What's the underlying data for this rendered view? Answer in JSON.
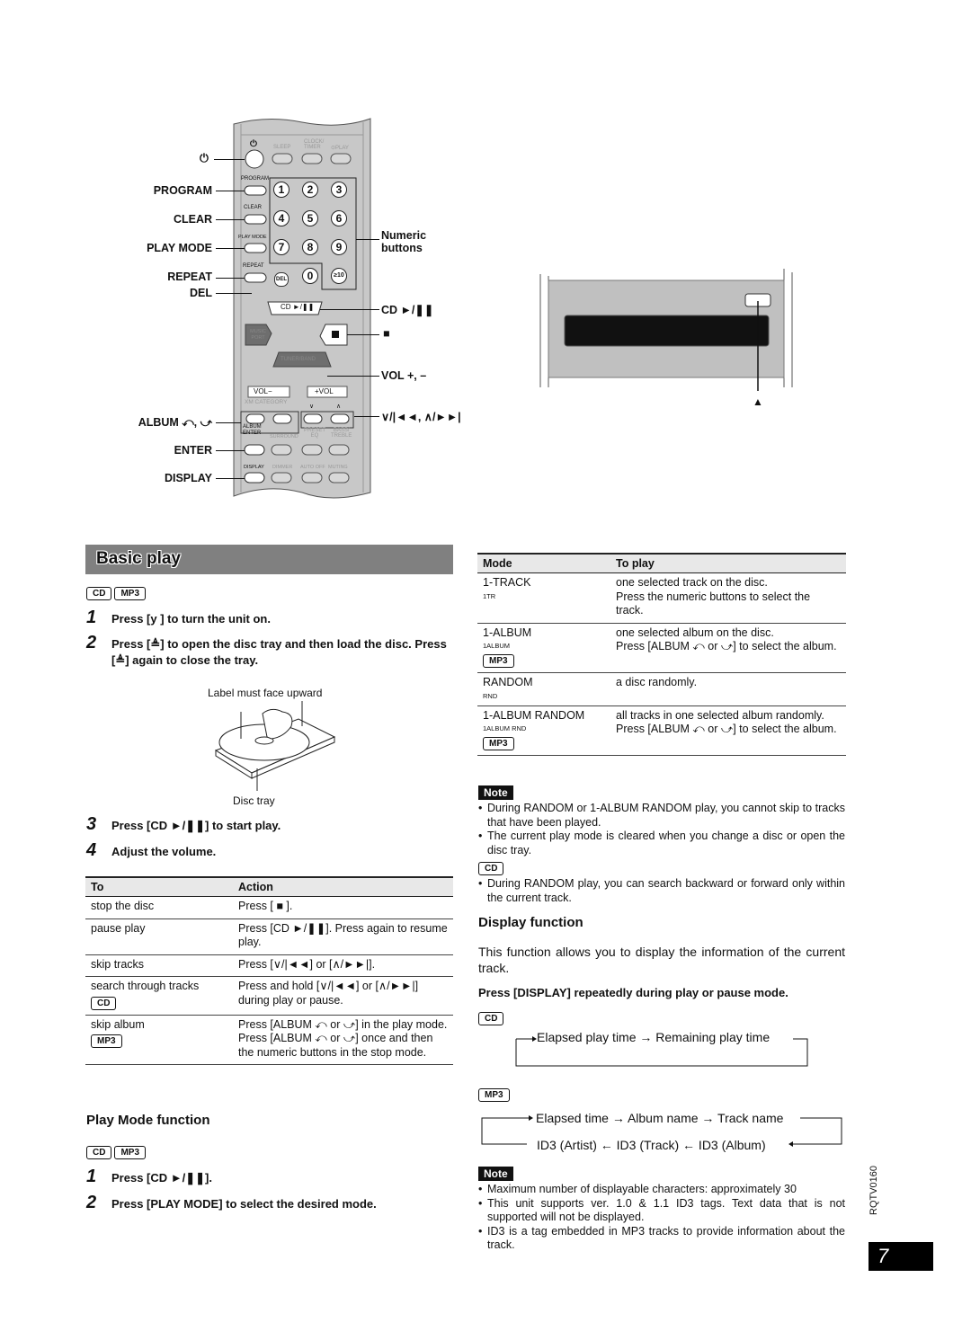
{
  "remote": {
    "left_labels": {
      "power": "⏻",
      "program": "PROGRAM",
      "clear": "CLEAR",
      "play_mode": "PLAY MODE",
      "repeat": "REPEAT",
      "del": "DEL",
      "album": "ALBUM ⤺, ⤻",
      "enter": "ENTER",
      "display": "DISPLAY"
    },
    "right_labels": {
      "numeric": "Numeric",
      "numeric2": "buttons",
      "cd_play": "CD ►/❚❚",
      "stop": "■",
      "vol": "VOL +, –",
      "skip": "∨/|◄◄, ∧/►►|"
    },
    "buttons": {
      "power_top": "⏻",
      "sleep": "SLEEP",
      "clock_timer_1": "CLOCK/",
      "clock_timer_2": "TIMER",
      "play_timer": "⊙PLAY",
      "program": "PROGRAM",
      "clear": "CLEAR",
      "play_mode": "PLAY MODE",
      "repeat": "REPEAT",
      "del": "DEL",
      "numbers": [
        "1",
        "2",
        "3",
        "4",
        "5",
        "6",
        "7",
        "8",
        "9",
        "0",
        "≥10"
      ],
      "cd_play": "CD ►/❚❚",
      "music_port": "MUSIC PORT",
      "stop": "■",
      "tuner_band": "TUNER/BAND",
      "vol_minus": "VOL−",
      "vol_plus": "+VOL",
      "xm_category": "XM CATEGORY",
      "down": "∨",
      "up": "∧",
      "album_enter_1": "ALBUM",
      "album_enter_2": "ENTER",
      "surround": "SURROUND",
      "preset_eq_1": "PRESET",
      "preset_eq_2": "EQ",
      "bass_treble_1": "BASS/",
      "bass_treble_2": "TREBLE",
      "display": "DISPLAY",
      "dimmer": "DIMMER",
      "auto_off": "AUTO OFF",
      "muting": "MUTING"
    }
  },
  "unit": {
    "eject_label": "▲"
  },
  "basic_play": {
    "title": "Basic play",
    "badges": [
      "CD",
      "MP3"
    ],
    "steps": [
      {
        "num": "1",
        "text": "Press [y ] to turn the unit on."
      },
      {
        "num": "2",
        "text": "Press [≜] to open the disc tray and then load the disc. Press [≜] again to close the tray."
      },
      {
        "num": "3",
        "text": "Press [CD ►/❚❚] to start play."
      },
      {
        "num": "4",
        "text": "Adjust the volume."
      }
    ],
    "illustration": {
      "label_top": "Label must face upward",
      "label_bottom": "Disc tray"
    },
    "table": {
      "headers": [
        "To",
        "Action"
      ],
      "rows": [
        {
          "to": "stop the disc",
          "badge": "",
          "action": [
            "Press [ ■ ]."
          ]
        },
        {
          "to": "pause play",
          "badge": "",
          "action": [
            "Press [CD ►/❚❚]. Press again to resume play."
          ]
        },
        {
          "to": "skip tracks",
          "badge": "",
          "action": [
            "Press [∨/|◄◄] or [∧/►►|]."
          ]
        },
        {
          "to": "search through tracks",
          "badge": "CD",
          "action": [
            "Press and hold [∨/|◄◄] or [∧/►►|] during play or pause."
          ]
        },
        {
          "to": "skip album",
          "badge": "MP3",
          "action": [
            "Press [ALBUM ⤺ or ⤻] in the play mode.",
            "Press [ALBUM ⤺ or ⤻] once and then the numeric buttons in the stop mode."
          ]
        }
      ]
    }
  },
  "play_mode": {
    "title": "Play Mode function",
    "badges": [
      "CD",
      "MP3"
    ],
    "steps": [
      {
        "num": "1",
        "text": "Press [CD ►/❚❚]."
      },
      {
        "num": "2",
        "text": "Press [PLAY MODE] to select the desired mode."
      }
    ],
    "table": {
      "headers": [
        "Mode",
        "To play"
      ],
      "rows": [
        {
          "mode": "1-TRACK",
          "indicator": "1TR",
          "badge": "",
          "play": [
            "one selected track on the disc.",
            "Press the numeric buttons to select the track."
          ]
        },
        {
          "mode": "1-ALBUM",
          "indicator": "1ALBUM",
          "badge": "MP3",
          "play": [
            "one selected album on the disc.",
            "Press [ALBUM ⤺ or ⤻] to select the album."
          ]
        },
        {
          "mode": "RANDOM",
          "indicator": "RND",
          "badge": "",
          "play": [
            "a disc randomly."
          ]
        },
        {
          "mode": "1-ALBUM RANDOM",
          "indicator": "1ALBUM RND",
          "badge": "MP3",
          "play": [
            "all tracks in one selected album randomly.",
            "Press [ALBUM ⤺ or ⤻] to select the album."
          ]
        }
      ]
    },
    "note_label": "Note",
    "notes": [
      "During RANDOM or 1-ALBUM RANDOM play, you cannot skip to tracks that have been played.",
      "The current play mode is cleared when you change a disc or open the disc tray."
    ],
    "cd_badge": "CD",
    "cd_notes": [
      "During RANDOM play, you can search backward or forward only within the current track."
    ]
  },
  "display_function": {
    "title": "Display function",
    "intro": "This function allows you to display the information of the current track.",
    "instruction": "Press [DISPLAY] repeatedly during play or pause mode.",
    "cd_badge": "CD",
    "cd_flow": "Elapsed play time → Remaining play time",
    "mp3_badge": "MP3",
    "mp3_flow_top": "Elapsed time → Album name → Track name",
    "mp3_flow_bottom": "ID3 (Artist) ← ID3 (Track) ← ID3 (Album)",
    "note_label": "Note",
    "notes": [
      "Maximum number of displayable characters: approximately 30",
      "This unit supports ver. 1.0 & 1.1 ID3 tags. Text data that is not supported will not be displayed.",
      "ID3 is a tag embedded in MP3 tracks to provide information about the track."
    ]
  },
  "footer": {
    "doc_code": "RQTV0160",
    "page_number": "7"
  }
}
